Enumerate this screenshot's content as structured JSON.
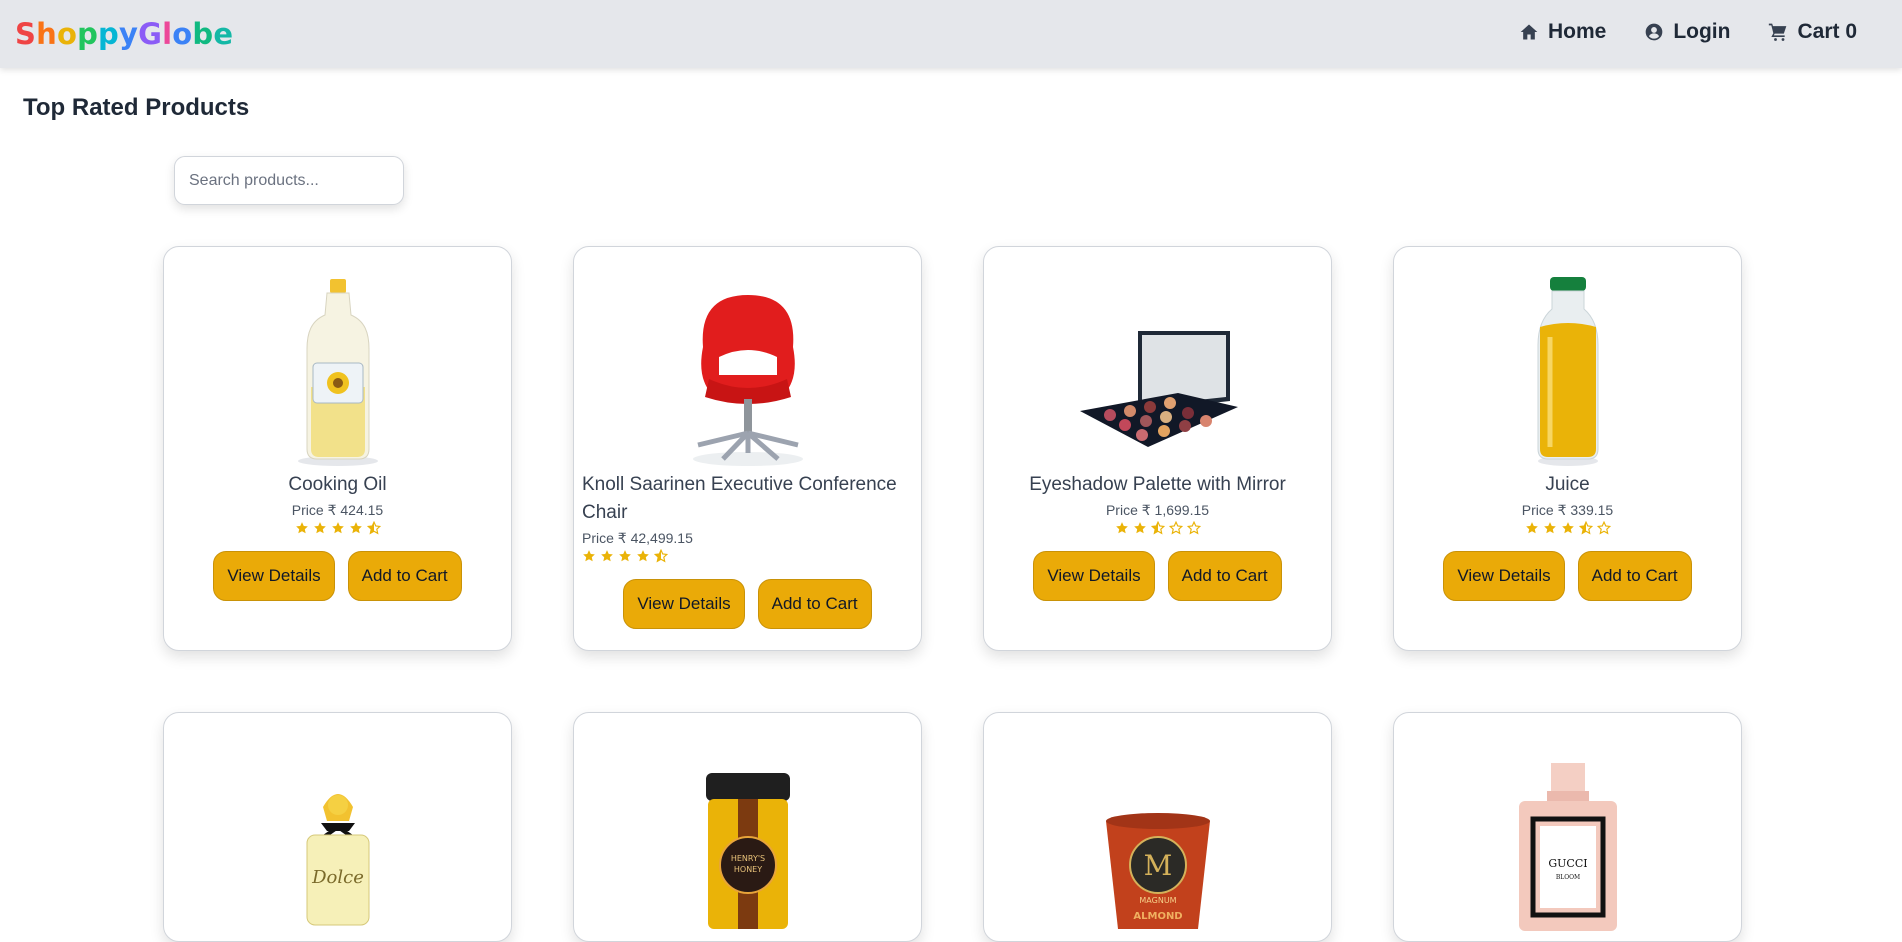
{
  "brand": {
    "letters": [
      {
        "ch": "S",
        "color": "#ef4444"
      },
      {
        "ch": "h",
        "color": "#f97316"
      },
      {
        "ch": "o",
        "color": "#eab308"
      },
      {
        "ch": "p",
        "color": "#22c55e"
      },
      {
        "ch": "p",
        "color": "#06b6d4"
      },
      {
        "ch": "y",
        "color": "#3b82f6"
      },
      {
        "ch": "G",
        "color": "#8b5cf6"
      },
      {
        "ch": "l",
        "color": "#ec4899"
      },
      {
        "ch": "o",
        "color": "#3b82f6"
      },
      {
        "ch": "b",
        "color": "#10b981"
      },
      {
        "ch": "e",
        "color": "#14b8a6"
      }
    ]
  },
  "nav": {
    "home": "Home",
    "login": "Login",
    "cart": "Cart 0"
  },
  "page_title": "Top Rated Products",
  "search": {
    "placeholder": "Search products...",
    "value": ""
  },
  "colors": {
    "accent": "#eaaa08",
    "star": "#eab308"
  },
  "buttons": {
    "view": "View Details",
    "add": "Add to Cart"
  },
  "products": [
    {
      "name": "Cooking Oil",
      "price": "Price ₹ 424.15",
      "rating": 4.5,
      "image": "cooking-oil-bottle"
    },
    {
      "name": "Knoll Saarinen Executive Conference Chair",
      "price": "Price ₹ 42,499.15",
      "rating": 4.5,
      "image": "red-office-chair"
    },
    {
      "name": "Eyeshadow Palette with Mirror",
      "price": "Price ₹ 1,699.15",
      "rating": 2.5,
      "image": "eyeshadow-palette"
    },
    {
      "name": "Juice",
      "price": "Price ₹ 339.15",
      "rating": 3.5,
      "image": "juice-bottle"
    },
    {
      "name": "",
      "price": "",
      "rating": null,
      "image": "dolce-perfume-bottle"
    },
    {
      "name": "",
      "price": "",
      "rating": null,
      "image": "honey-jar"
    },
    {
      "name": "",
      "price": "",
      "rating": null,
      "image": "ice-cream-tub"
    },
    {
      "name": "",
      "price": "",
      "rating": null,
      "image": "gucci-bloom-perfume"
    }
  ],
  "image_labels": {
    "honey": [
      "HENRY'S",
      "HONEY"
    ],
    "icecream_m": "M",
    "icecream_brand": "MAGNUM",
    "icecream_flavor": "ALMOND",
    "gucci": [
      "GUCCI",
      "BLOOM"
    ],
    "dolce": "Dolce"
  }
}
